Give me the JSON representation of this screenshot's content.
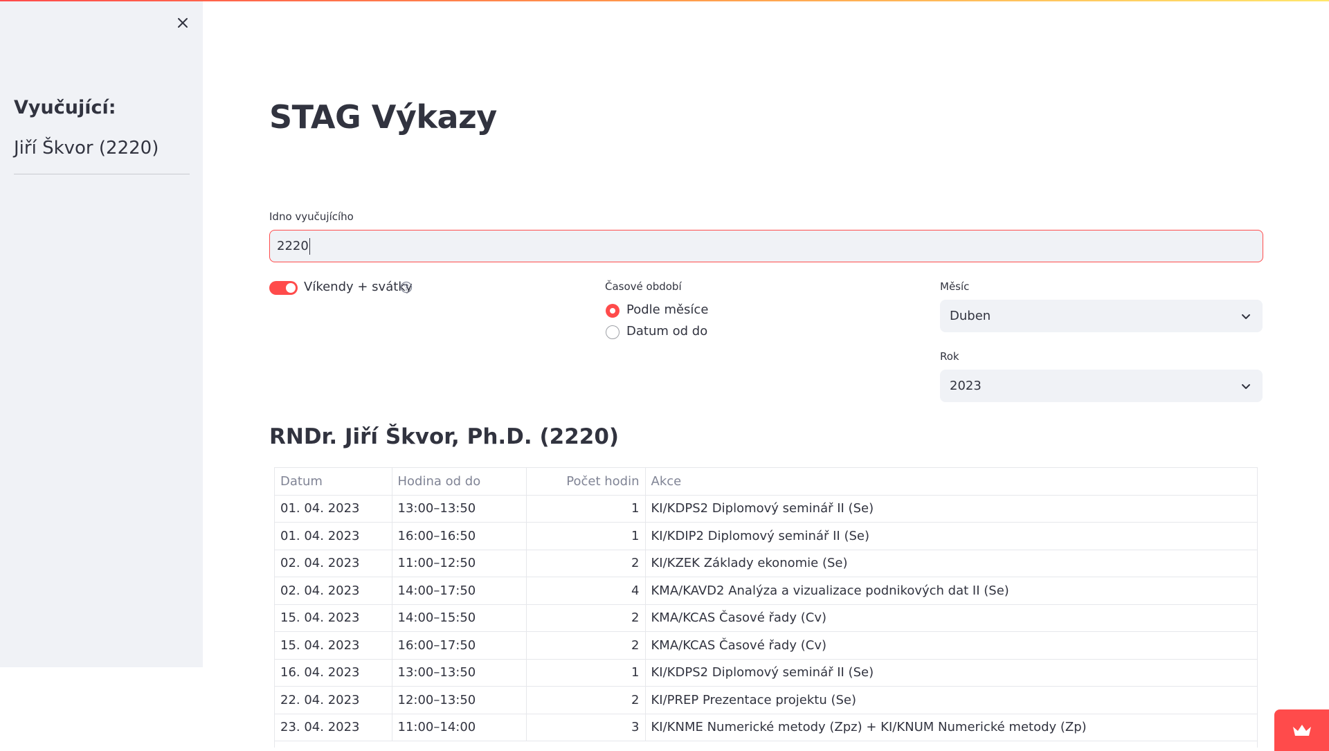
{
  "sidebar": {
    "title": "Vyučující:",
    "teacher": "Jiří Škvor (2220)"
  },
  "main": {
    "title": "STAG Výkazy",
    "idno_label": "Idno vyučujícího",
    "idno_value": "2220",
    "toggle_label": "Víkendy + svátky",
    "toggle_on": true,
    "period_label": "Časové období",
    "period_options": [
      "Podle měsíce",
      "Datum od do"
    ],
    "period_selected": "Podle měsíce",
    "month_label": "Měsíc",
    "month_value": "Duben",
    "year_label": "Rok",
    "year_value": "2023",
    "teacher_heading": "RNDr. Jiří Škvor, Ph.D. (2220)"
  },
  "table": {
    "columns": [
      "Datum",
      "Hodina od do",
      "Počet hodin",
      "Akce"
    ],
    "rows": [
      [
        "01. 04. 2023",
        "13:00–13:50",
        "1",
        "KI/KDPS2 Diplomový seminář II (Se)"
      ],
      [
        "01. 04. 2023",
        "16:00–16:50",
        "1",
        "KI/KDIP2 Diplomový seminář II (Se)"
      ],
      [
        "02. 04. 2023",
        "11:00–12:50",
        "2",
        "KI/KZEK Základy ekonomie (Se)"
      ],
      [
        "02. 04. 2023",
        "14:00–17:50",
        "4",
        "KMA/KAVD2 Analýza a vizualizace podnikových dat II (Se)"
      ],
      [
        "15. 04. 2023",
        "14:00–15:50",
        "2",
        "KMA/KCAS Časové řady (Cv)"
      ],
      [
        "15. 04. 2023",
        "16:00–17:50",
        "2",
        "KMA/KCAS Časové řady (Cv)"
      ],
      [
        "16. 04. 2023",
        "13:00–13:50",
        "1",
        "KI/KDPS2 Diplomový seminář II (Se)"
      ],
      [
        "22. 04. 2023",
        "12:00–13:50",
        "2",
        "KI/PREP Prezentace projektu (Se)"
      ],
      [
        "23. 04. 2023",
        "11:00–14:00",
        "3",
        "KI/KNME Numerické metody (Zpz) + KI/KNUM Numerické metody (Zp)"
      ]
    ]
  },
  "icons": {
    "close": "close-icon",
    "help": "help-icon",
    "chevron": "chevron-down-icon",
    "crown": "crown-icon"
  },
  "colors": {
    "accent": "#ff4b4b",
    "sidebar_bg": "#f0f2f6",
    "text": "#31333f"
  }
}
